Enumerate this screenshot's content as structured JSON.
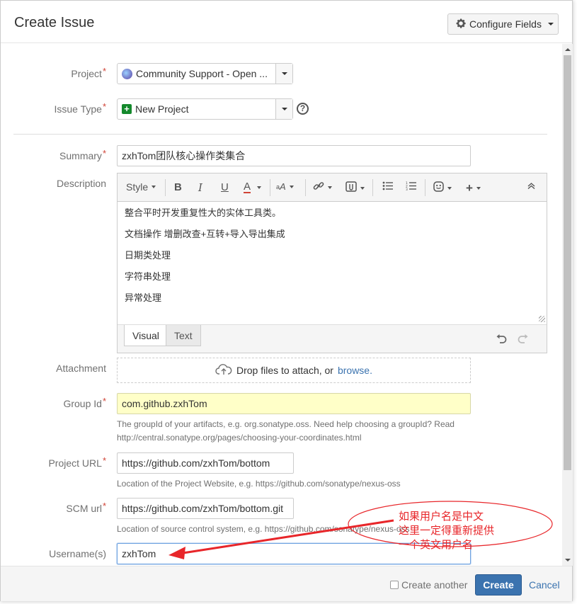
{
  "dialog": {
    "title": "Create Issue",
    "configure_fields_label": "Configure Fields"
  },
  "fields": {
    "project": {
      "label": "Project",
      "value": "Community Support - Open ..."
    },
    "issue_type": {
      "label": "Issue Type",
      "value": "New Project"
    },
    "summary": {
      "label": "Summary",
      "value": "zxhTom团队核心操作类集合"
    },
    "description": {
      "label": "Description",
      "toolbar": {
        "style_label": "Style"
      },
      "lines": [
        "整合平时开发重复性大的实体工具类。",
        "文档操作 增删改查+互转+导入导出集成",
        "日期类处理",
        "字符串处理",
        "异常处理"
      ],
      "tabs": {
        "visual": "Visual",
        "text": "Text"
      }
    },
    "attachment": {
      "label": "Attachment",
      "drop_text": "Drop files to attach, or",
      "browse_link": "browse."
    },
    "group_id": {
      "label": "Group Id",
      "value": "com.github.zxhTom",
      "help_line1": "The groupId of your artifacts, e.g. org.sonatype.oss. Need help choosing a groupId? Read",
      "help_line2": "http://central.sonatype.org/pages/choosing-your-coordinates.html"
    },
    "project_url": {
      "label": "Project URL",
      "value": "https://github.com/zxhTom/bottom",
      "help": "Location of the Project Website, e.g. https://github.com/sonatype/nexus-oss"
    },
    "scm_url": {
      "label": "SCM url",
      "value": "https://github.com/zxhTom/bottom.git",
      "help": "Location of source control system, e.g. https://github.com/sonatype/nexus-oss"
    },
    "username": {
      "label": "Username(s)",
      "value": "zxhTom"
    }
  },
  "footer": {
    "create_another_label": "Create another",
    "create_label": "Create",
    "cancel_label": "Cancel"
  },
  "annotation": {
    "lines": [
      "如果用户名是中文",
      "这里一定得重新提供",
      "一个英文用户名"
    ],
    "color": "#e8262a"
  },
  "colors": {
    "accent": "#3b73af",
    "required": "#d04437",
    "highlight_field": "#ffffc8"
  }
}
